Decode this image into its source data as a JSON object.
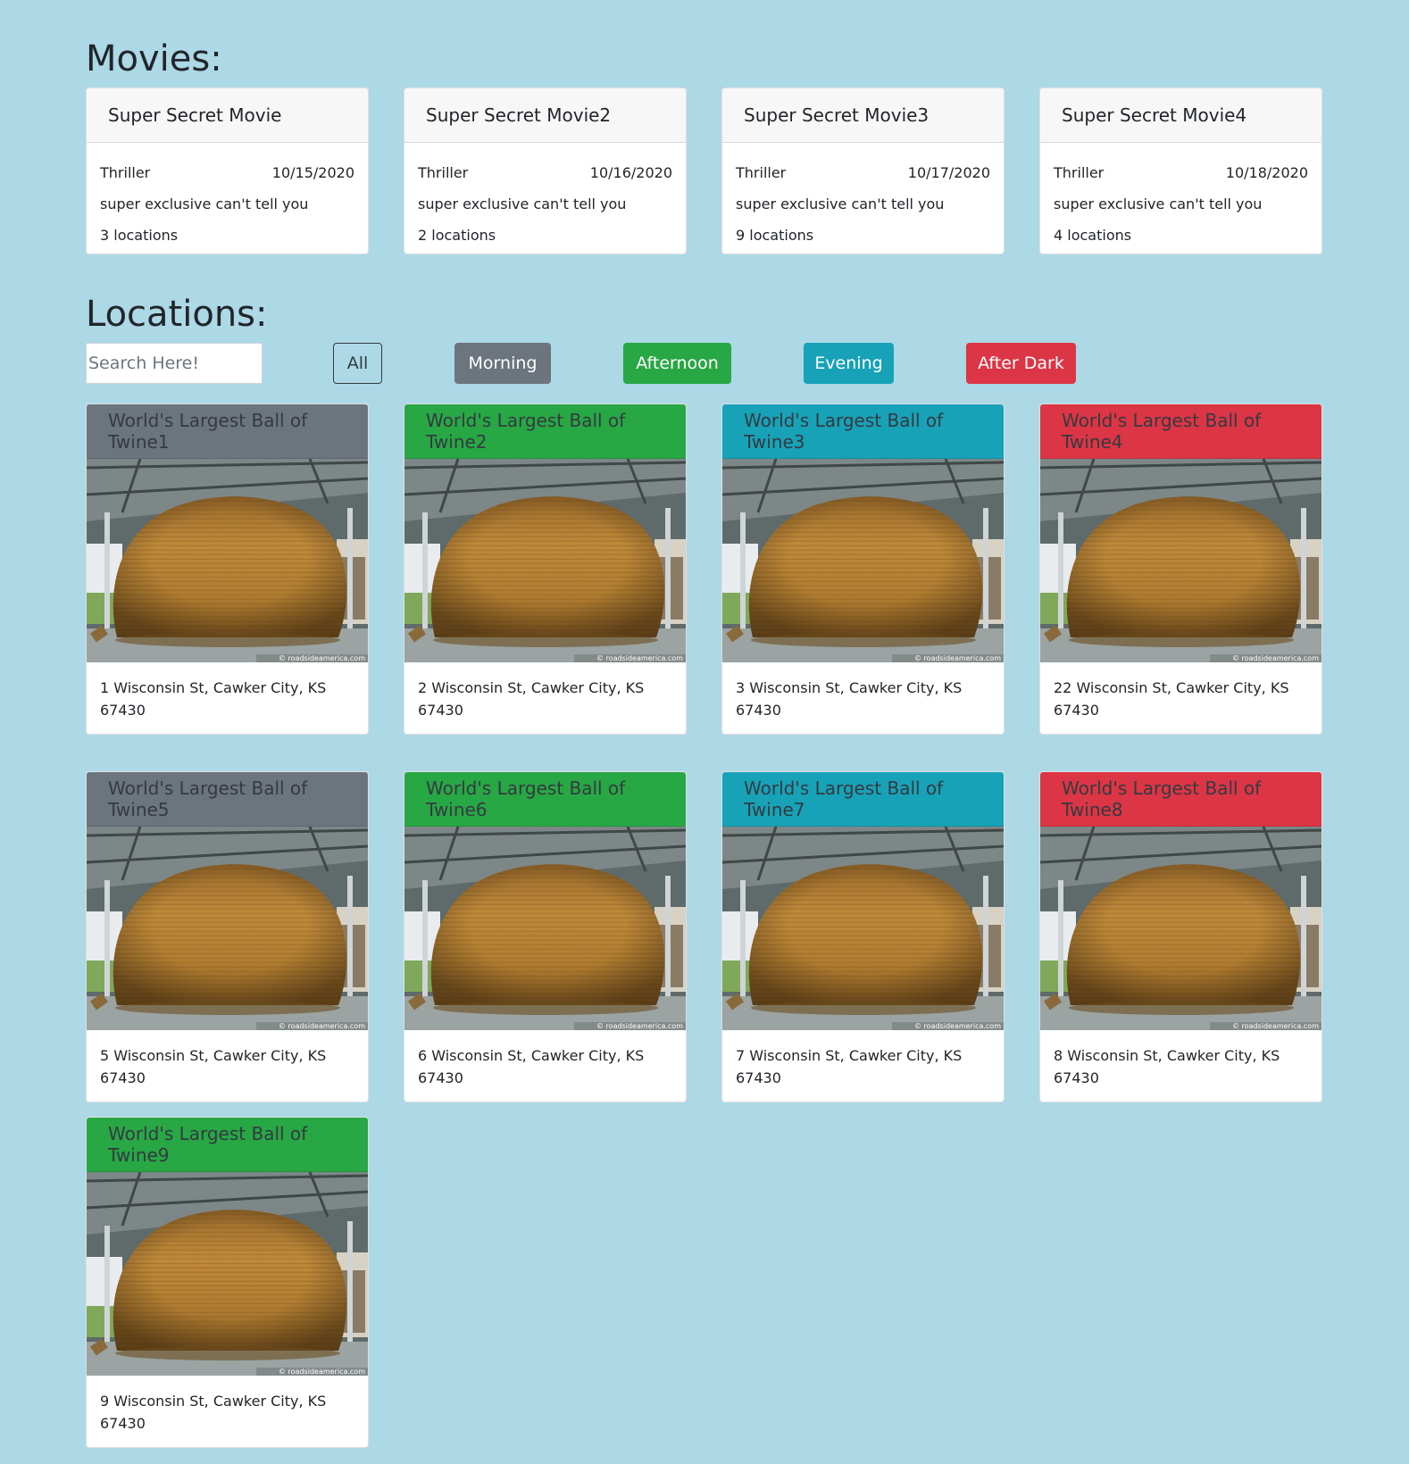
{
  "movies": {
    "title": "Movies:",
    "items": [
      {
        "name": "Super Secret Movie",
        "genre": "Thriller",
        "date": "10/15/2020",
        "description": "super exclusive can't tell you",
        "locations": "3 locations"
      },
      {
        "name": "Super Secret Movie2",
        "genre": "Thriller",
        "date": "10/16/2020",
        "description": "super exclusive can't tell you",
        "locations": "2 locations"
      },
      {
        "name": "Super Secret Movie3",
        "genre": "Thriller",
        "date": "10/17/2020",
        "description": "super exclusive can't tell you",
        "locations": "9 locations"
      },
      {
        "name": "Super Secret Movie4",
        "genre": "Thriller",
        "date": "10/18/2020",
        "description": "super exclusive can't tell you",
        "locations": "4 locations"
      }
    ]
  },
  "locations": {
    "title": "Locations:",
    "search_placeholder": "Search Here!",
    "filters": {
      "all": "All",
      "morning": "Morning",
      "afternoon": "Afternoon",
      "evening": "Evening",
      "after_dark": "After Dark"
    },
    "photo_credit": "© roadsideamerica.com",
    "items": [
      {
        "name": "World's Largest Ball of Twine1",
        "address": "1 Wisconsin St, Cawker City, KS 67430",
        "time": "Morning"
      },
      {
        "name": "World's Largest Ball of Twine2",
        "address": "2 Wisconsin St, Cawker City, KS 67430",
        "time": "Afternoon"
      },
      {
        "name": "World's Largest Ball of Twine3",
        "address": "3 Wisconsin St, Cawker City, KS 67430",
        "time": "Evening"
      },
      {
        "name": "World's Largest Ball of Twine4",
        "address": "22 Wisconsin St, Cawker City, KS 67430",
        "time": "After Dark"
      },
      {
        "name": "World's Largest Ball of Twine5",
        "address": "5 Wisconsin St, Cawker City, KS 67430",
        "time": "Morning"
      },
      {
        "name": "World's Largest Ball of Twine6",
        "address": "6 Wisconsin St, Cawker City, KS 67430",
        "time": "Afternoon"
      },
      {
        "name": "World's Largest Ball of Twine7",
        "address": "7 Wisconsin St, Cawker City, KS 67430",
        "time": "Evening"
      },
      {
        "name": "World's Largest Ball of Twine8",
        "address": "8 Wisconsin St, Cawker City, KS 67430",
        "time": "After Dark"
      },
      {
        "name": "World's Largest Ball of Twine9",
        "address": "9 Wisconsin St, Cawker City, KS 67430",
        "time": "Afternoon"
      }
    ]
  },
  "colors": {
    "background": "#add8e6",
    "morning": "#6c757d",
    "afternoon": "#28a745",
    "evening": "#17a2b8",
    "after_dark": "#dc3545"
  }
}
